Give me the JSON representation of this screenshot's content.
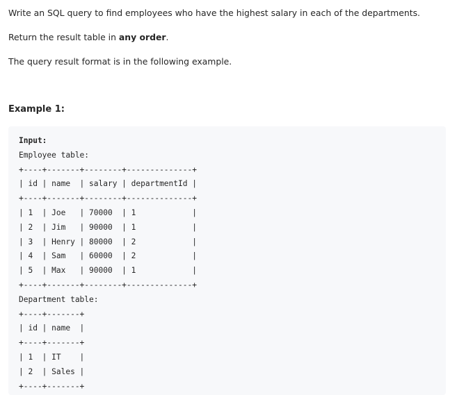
{
  "description": {
    "line1": "Write an SQL query to find employees who have the highest salary in each of the departments.",
    "line2_prefix": "Return the result table in ",
    "line2_bold": "any order",
    "line2_suffix": ".",
    "line3": "The query result format is in the following example."
  },
  "example": {
    "heading": "Example 1:",
    "input_label": "Input:",
    "lines": [
      "Employee table:",
      "+----+-------+--------+--------------+",
      "| id | name  | salary | departmentId |",
      "+----+-------+--------+--------------+",
      "| 1  | Joe   | 70000  | 1            |",
      "| 2  | Jim   | 90000  | 1            |",
      "| 3  | Henry | 80000  | 2            |",
      "| 4  | Sam   | 60000  | 2            |",
      "| 5  | Max   | 90000  | 1            |",
      "+----+-------+--------+--------------+",
      "Department table:",
      "+----+-------+",
      "| id | name  |",
      "+----+-------+",
      "| 1  | IT    |",
      "| 2  | Sales |",
      "+----+-------+"
    ]
  }
}
